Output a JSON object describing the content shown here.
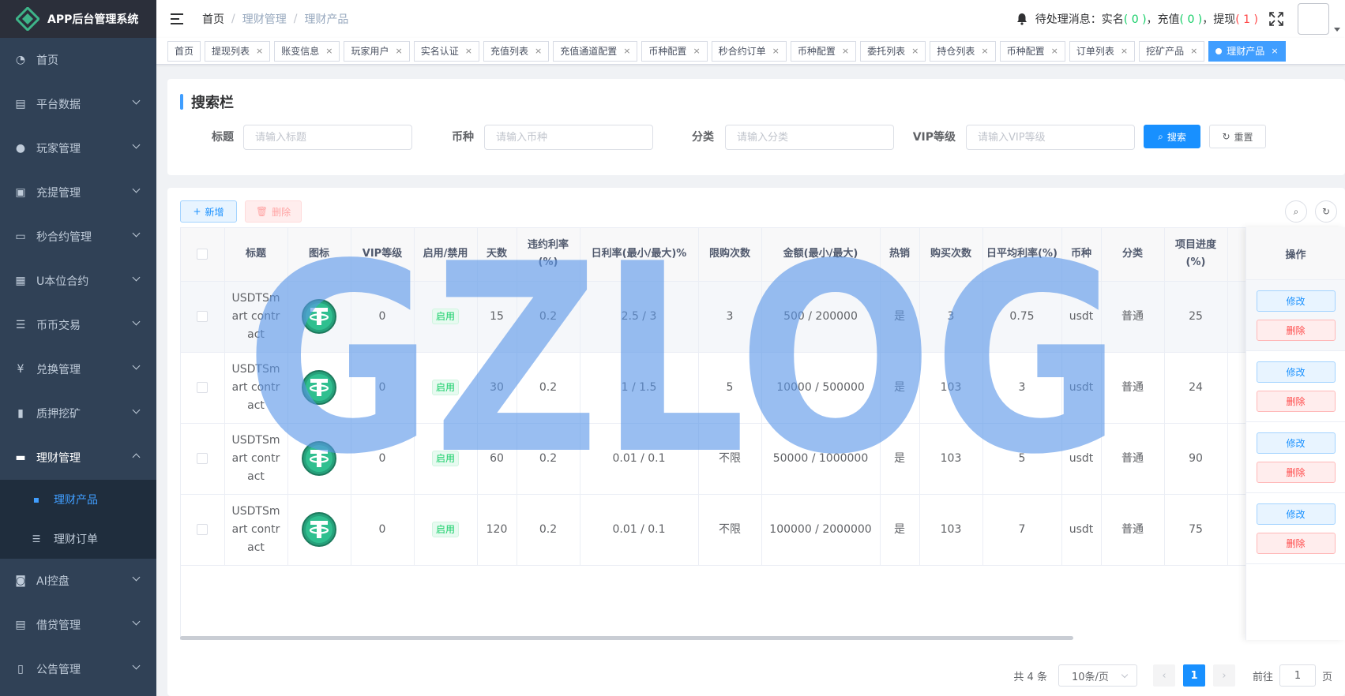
{
  "app": {
    "title": "APP后台管理系统"
  },
  "sidebar": {
    "items": [
      {
        "label": "首页",
        "icon": "dashboard-icon",
        "glyph": "◔"
      },
      {
        "label": "平台数据",
        "icon": "book-icon",
        "glyph": "▤"
      },
      {
        "label": "玩家管理",
        "icon": "user-icon",
        "glyph": "●"
      },
      {
        "label": "充提管理",
        "icon": "clipboard-icon",
        "glyph": "▣"
      },
      {
        "label": "秒合约管理",
        "icon": "monitor-icon",
        "glyph": "▭"
      },
      {
        "label": "U本位合约",
        "icon": "grid-icon",
        "glyph": "▦"
      },
      {
        "label": "币币交易",
        "icon": "list-icon",
        "glyph": "☰"
      },
      {
        "label": "兑换管理",
        "icon": "yen-icon",
        "glyph": "¥"
      },
      {
        "label": "质押挖矿",
        "icon": "bar-chart-icon",
        "glyph": "▮"
      },
      {
        "label": "理财管理",
        "icon": "document-icon",
        "glyph": "▬"
      }
    ],
    "sub_items": [
      {
        "label": "理财产品",
        "icon": "card-icon",
        "glyph": "▪"
      },
      {
        "label": "理财订单",
        "icon": "list-icon",
        "glyph": "☰"
      }
    ],
    "bottom_items": [
      {
        "label": "AI控盘",
        "icon": "robot-icon",
        "glyph": "◙"
      },
      {
        "label": "借贷管理",
        "icon": "book-icon",
        "glyph": "▤"
      },
      {
        "label": "公告管理",
        "icon": "open-book-icon",
        "glyph": "▯"
      }
    ]
  },
  "navbar": {
    "breadcrumb": [
      "首页",
      "理财管理",
      "理财产品"
    ],
    "pending_label": "待处理消息：",
    "realname_label": "实名",
    "realname_count": "( 0 )",
    "recharge_label": "，充值",
    "recharge_count": "( 0 )",
    "withdraw_label": "，提现",
    "withdraw_count": "( 1 )"
  },
  "tags": [
    "首页",
    "提现列表",
    "账变信息",
    "玩家用户",
    "实名认证",
    "充值列表",
    "充值通道配置",
    "币种配置",
    "秒合约订单",
    "币种配置",
    "委托列表",
    "持仓列表",
    "币种配置",
    "订单列表",
    "挖矿产品",
    "理财产品"
  ],
  "search": {
    "title": "搜索栏",
    "fields": [
      {
        "label": "标题",
        "placeholder": "请输入标题"
      },
      {
        "label": "币种",
        "placeholder": "请输入币种"
      },
      {
        "label": "分类",
        "placeholder": "请输入分类"
      },
      {
        "label": "VIP等级",
        "placeholder": "请输入VIP等级"
      }
    ],
    "search_btn": "搜索",
    "reset_btn": "重置"
  },
  "toolbar": {
    "add": "新增",
    "delete": "删除"
  },
  "table": {
    "headers": [
      "标题",
      "图标",
      "VIP等级",
      "启用/禁用",
      "天数",
      "违约利率(%)",
      "日利率(最小/最大)%",
      "限购次数",
      "金额(最小/最大)",
      "热销",
      "购买次数",
      "日平均利率(%)",
      "币种",
      "分类",
      "项目进度(%)"
    ],
    "ops_header": "操作",
    "edit_label": "修改",
    "delete_label": "删除",
    "rows": [
      {
        "title": "USDTSmart contract",
        "vip": "0",
        "status": "启用",
        "days": "15",
        "penalty": "0.2",
        "daily_rate": "2.5 / 3",
        "limit": "3",
        "amount": "500 / 200000",
        "hot": "是",
        "buys": "3",
        "avg_rate": "0.75",
        "coin": "usdt",
        "category": "普通",
        "progress": "25"
      },
      {
        "title": "USDTSmart contract",
        "vip": "0",
        "status": "启用",
        "days": "30",
        "penalty": "0.2",
        "daily_rate": "1 / 1.5",
        "limit": "5",
        "amount": "10000 / 500000",
        "hot": "是",
        "buys": "103",
        "avg_rate": "3",
        "coin": "usdt",
        "category": "普通",
        "progress": "24"
      },
      {
        "title": "USDTSmart contract",
        "vip": "0",
        "status": "启用",
        "days": "60",
        "penalty": "0.2",
        "daily_rate": "0.01 / 0.1",
        "limit": "不限",
        "amount": "50000 / 1000000",
        "hot": "是",
        "buys": "103",
        "avg_rate": "5",
        "coin": "usdt",
        "category": "普通",
        "progress": "90"
      },
      {
        "title": "USDTSmart contract",
        "vip": "0",
        "status": "启用",
        "days": "120",
        "penalty": "0.2",
        "daily_rate": "0.01 / 0.1",
        "limit": "不限",
        "amount": "100000 / 2000000",
        "hot": "是",
        "buys": "103",
        "avg_rate": "7",
        "coin": "usdt",
        "category": "普通",
        "progress": "75"
      }
    ]
  },
  "pagination": {
    "total": "共 4 条",
    "page_size": "10条/页",
    "current": "1",
    "goto_label": "前往",
    "goto_value": "1",
    "page_label": "页"
  },
  "watermark": {
    "text": "GZLOG"
  },
  "colors": {
    "primary": "#1890ff",
    "sidebar": "#304156",
    "success": "#13ce66",
    "danger": "#ff4949",
    "watermark": "#5a96e8"
  }
}
